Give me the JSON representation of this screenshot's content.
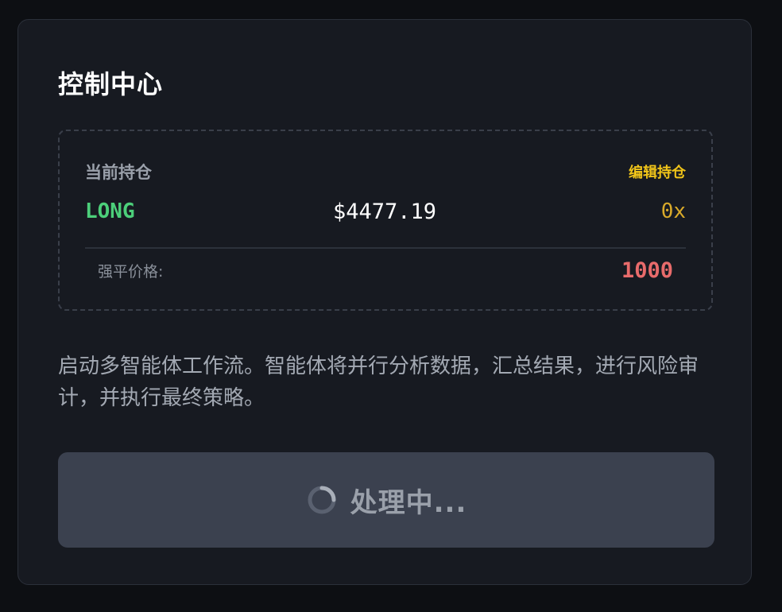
{
  "panel": {
    "title": "控制中心"
  },
  "position": {
    "label": "当前持仓",
    "edit_label": "编辑持仓",
    "side": "LONG",
    "price": "$4477.19",
    "leverage": "0x",
    "liquidation_label": "强平价格:",
    "liquidation_value": "1000"
  },
  "description": "启动多智能体工作流。智能体将并行分析数据，汇总结果，进行风险审计，并执行最终策略。",
  "action": {
    "label": "处理中...",
    "spinner_icon": "loading-spinner-icon"
  },
  "colors": {
    "long": "#4ccf7a",
    "leverage": "#d9aa2a",
    "liquidation": "#e86b6b",
    "edit": "#f0c419"
  }
}
